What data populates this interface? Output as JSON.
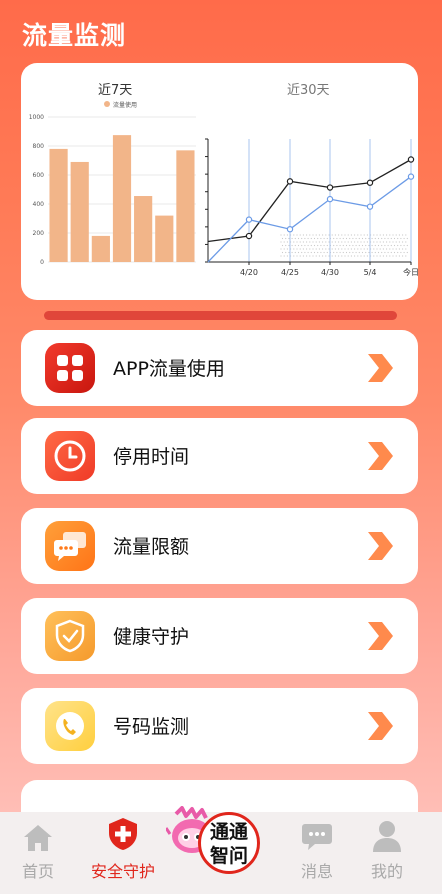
{
  "header": {
    "title": "流量监测"
  },
  "chart_tabs": {
    "tab7": "近7天",
    "tab30": "近30天"
  },
  "chart_data": [
    {
      "type": "bar",
      "legend": "流量使用",
      "ylim": [
        0,
        1000
      ],
      "y_ticks": [
        "0",
        "200",
        "400",
        "600",
        "800",
        "1000"
      ],
      "values": [
        780,
        690,
        180,
        875,
        455,
        320,
        770
      ]
    },
    {
      "type": "line",
      "categories": [
        "4/20",
        "4/25",
        "4/30",
        "5/4",
        "今日"
      ],
      "series": [
        {
          "color": "#222222",
          "values": [
            190,
            590,
            545,
            580,
            750
          ]
        },
        {
          "color": "#6c9be6",
          "values": [
            310,
            240,
            460,
            405,
            625
          ]
        }
      ],
      "start_values": [
        150,
        0
      ],
      "ylim": [
        0,
        900
      ]
    }
  ],
  "menu": [
    {
      "label": "APP流量使用",
      "icon": "app-grid-icon"
    },
    {
      "label": "停用时间",
      "icon": "clock-icon"
    },
    {
      "label": "流量限额",
      "icon": "chat-bubble-icon"
    },
    {
      "label": "健康守护",
      "icon": "shield-check-icon"
    },
    {
      "label": "号码监测",
      "icon": "phone-icon"
    }
  ],
  "tabbar": {
    "home": "首页",
    "security": "安全守护",
    "assistant_line1": "通通",
    "assistant_line2": "智问",
    "messages": "消息",
    "mine": "我的"
  },
  "colors": {
    "accent": "#e0261c",
    "bar": "#f2b589",
    "brand": "#ff6b4a"
  }
}
